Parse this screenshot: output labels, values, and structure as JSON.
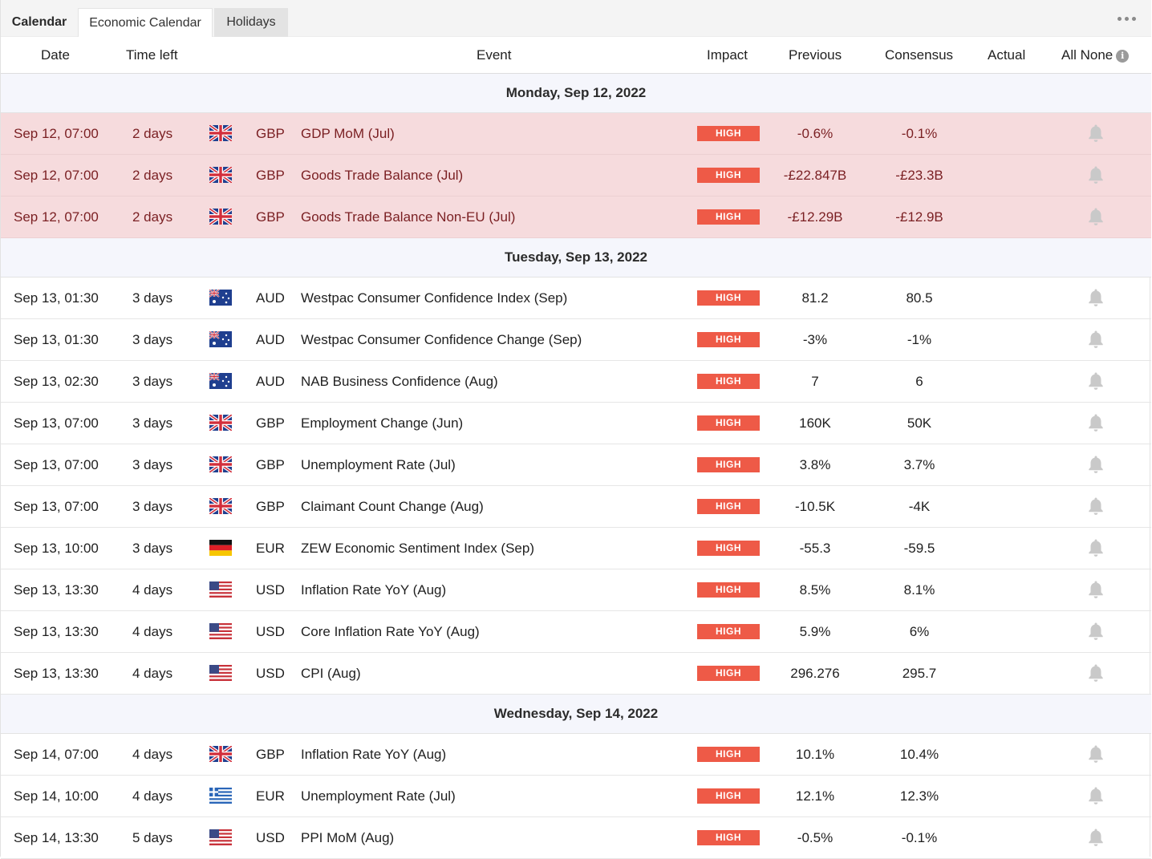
{
  "tabs": {
    "calendar": "Calendar",
    "economic": "Economic Calendar",
    "holidays": "Holidays"
  },
  "header": {
    "date": "Date",
    "time_left": "Time left",
    "event": "Event",
    "impact": "Impact",
    "previous": "Previous",
    "consensus": "Consensus",
    "actual": "Actual",
    "all_none": "All None",
    "info_icon": "info-icon"
  },
  "colors": {
    "impact_high": "#ee5a47",
    "past_row_bg": "#f6dbdd",
    "day_separator_bg": "#f5f6fc"
  },
  "days": [
    {
      "label": "Monday, Sep 12, 2022",
      "events": [
        {
          "date": "Sep 12, 07:00",
          "time_left": "2 days",
          "flag": "uk",
          "currency": "GBP",
          "event": "GDP MoM (Jul)",
          "impact": "HIGH",
          "previous": "-0.6%",
          "consensus": "-0.1%",
          "actual": "",
          "past": true
        },
        {
          "date": "Sep 12, 07:00",
          "time_left": "2 days",
          "flag": "uk",
          "currency": "GBP",
          "event": "Goods Trade Balance (Jul)",
          "impact": "HIGH",
          "previous": "-£22.847B",
          "consensus": "-£23.3B",
          "actual": "",
          "past": true
        },
        {
          "date": "Sep 12, 07:00",
          "time_left": "2 days",
          "flag": "uk",
          "currency": "GBP",
          "event": "Goods Trade Balance Non-EU (Jul)",
          "impact": "HIGH",
          "previous": "-£12.29B",
          "consensus": "-£12.9B",
          "actual": "",
          "past": true
        }
      ]
    },
    {
      "label": "Tuesday, Sep 13, 2022",
      "events": [
        {
          "date": "Sep 13, 01:30",
          "time_left": "3 days",
          "flag": "au",
          "currency": "AUD",
          "event": "Westpac Consumer Confidence Index (Sep)",
          "impact": "HIGH",
          "previous": "81.2",
          "consensus": "80.5",
          "actual": "",
          "past": false
        },
        {
          "date": "Sep 13, 01:30",
          "time_left": "3 days",
          "flag": "au",
          "currency": "AUD",
          "event": "Westpac Consumer Confidence Change (Sep)",
          "impact": "HIGH",
          "previous": "-3%",
          "consensus": "-1%",
          "actual": "",
          "past": false
        },
        {
          "date": "Sep 13, 02:30",
          "time_left": "3 days",
          "flag": "au",
          "currency": "AUD",
          "event": "NAB Business Confidence (Aug)",
          "impact": "HIGH",
          "previous": "7",
          "consensus": "6",
          "actual": "",
          "past": false
        },
        {
          "date": "Sep 13, 07:00",
          "time_left": "3 days",
          "flag": "uk",
          "currency": "GBP",
          "event": "Employment Change (Jun)",
          "impact": "HIGH",
          "previous": "160K",
          "consensus": "50K",
          "actual": "",
          "past": false
        },
        {
          "date": "Sep 13, 07:00",
          "time_left": "3 days",
          "flag": "uk",
          "currency": "GBP",
          "event": "Unemployment Rate (Jul)",
          "impact": "HIGH",
          "previous": "3.8%",
          "consensus": "3.7%",
          "actual": "",
          "past": false
        },
        {
          "date": "Sep 13, 07:00",
          "time_left": "3 days",
          "flag": "uk",
          "currency": "GBP",
          "event": "Claimant Count Change (Aug)",
          "impact": "HIGH",
          "previous": "-10.5K",
          "consensus": "-4K",
          "actual": "",
          "past": false
        },
        {
          "date": "Sep 13, 10:00",
          "time_left": "3 days",
          "flag": "de",
          "currency": "EUR",
          "event": "ZEW Economic Sentiment Index (Sep)",
          "impact": "HIGH",
          "previous": "-55.3",
          "consensus": "-59.5",
          "actual": "",
          "past": false
        },
        {
          "date": "Sep 13, 13:30",
          "time_left": "4 days",
          "flag": "us",
          "currency": "USD",
          "event": "Inflation Rate YoY (Aug)",
          "impact": "HIGH",
          "previous": "8.5%",
          "consensus": "8.1%",
          "actual": "",
          "past": false
        },
        {
          "date": "Sep 13, 13:30",
          "time_left": "4 days",
          "flag": "us",
          "currency": "USD",
          "event": "Core Inflation Rate YoY (Aug)",
          "impact": "HIGH",
          "previous": "5.9%",
          "consensus": "6%",
          "actual": "",
          "past": false
        },
        {
          "date": "Sep 13, 13:30",
          "time_left": "4 days",
          "flag": "us",
          "currency": "USD",
          "event": "CPI (Aug)",
          "impact": "HIGH",
          "previous": "296.276",
          "consensus": "295.7",
          "actual": "",
          "past": false
        }
      ]
    },
    {
      "label": "Wednesday, Sep 14, 2022",
      "events": [
        {
          "date": "Sep 14, 07:00",
          "time_left": "4 days",
          "flag": "uk",
          "currency": "GBP",
          "event": "Inflation Rate YoY (Aug)",
          "impact": "HIGH",
          "previous": "10.1%",
          "consensus": "10.4%",
          "actual": "",
          "past": false
        },
        {
          "date": "Sep 14, 10:00",
          "time_left": "4 days",
          "flag": "gr",
          "currency": "EUR",
          "event": "Unemployment Rate (Jul)",
          "impact": "HIGH",
          "previous": "12.1%",
          "consensus": "12.3%",
          "actual": "",
          "past": false
        },
        {
          "date": "Sep 14, 13:30",
          "time_left": "5 days",
          "flag": "us",
          "currency": "USD",
          "event": "PPI MoM (Aug)",
          "impact": "HIGH",
          "previous": "-0.5%",
          "consensus": "-0.1%",
          "actual": "",
          "past": false
        }
      ]
    }
  ]
}
